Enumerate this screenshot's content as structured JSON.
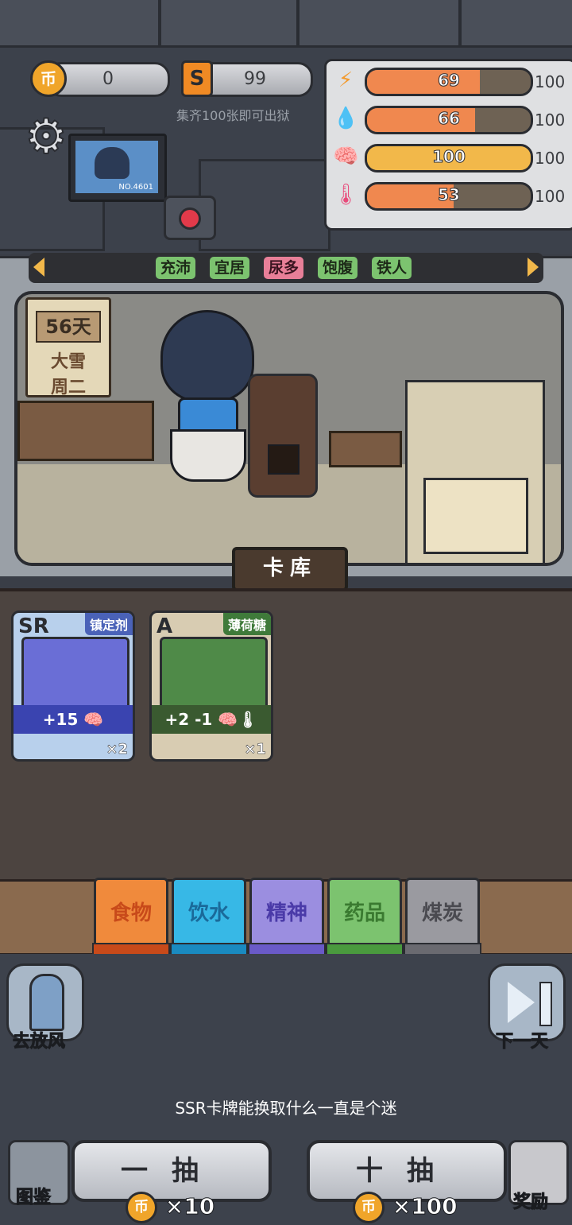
{
  "currency": {
    "coins": "0",
    "coin_glyph": "币",
    "cards": "99",
    "card_glyph": "S",
    "hint": "集齐100张即可出狱"
  },
  "stats": [
    {
      "icon": "energy-icon",
      "glyph": "⚡",
      "value": 69,
      "max": "100",
      "color": "#f0884f"
    },
    {
      "icon": "water-icon",
      "glyph": "💧",
      "value": 66,
      "max": "100",
      "color": "#f0884f"
    },
    {
      "icon": "brain-icon",
      "glyph": "🧠",
      "value": 100,
      "max": "100",
      "color": "#f2b84a"
    },
    {
      "icon": "thermometer-icon",
      "glyph": "🌡",
      "value": 53,
      "max": "100",
      "color": "#f0884f"
    }
  ],
  "camera": {
    "tag": "NO.4601"
  },
  "tags": [
    "充沛",
    "宜居",
    "尿多",
    "饱腹",
    "铁人"
  ],
  "calendar": {
    "days": "56天",
    "weather": "大雪",
    "weekday": "周二"
  },
  "card_library_title": "卡库",
  "cards": [
    {
      "rank": "SR",
      "name": "镇定剂",
      "effect": "+15",
      "count": "×2"
    },
    {
      "rank": "A",
      "name": "薄荷糖",
      "effect": "+2  -1",
      "count": "×1"
    }
  ],
  "categories": [
    {
      "label": "食物",
      "color": "#f08a3c"
    },
    {
      "label": "饮水",
      "color": "#37b8e6"
    },
    {
      "label": "精神",
      "color": "#9b8ee0"
    },
    {
      "label": "药品",
      "color": "#7cc36f"
    },
    {
      "label": "煤炭",
      "color": "#9a9aa0"
    }
  ],
  "actions": {
    "go_out": "去放风",
    "next_day": "下一天",
    "gallery": "图鉴",
    "reward": "奖励"
  },
  "tip": "SSR卡牌能换取什么一直是个迷",
  "draw_one": {
    "label": "一抽",
    "cost": "×10"
  },
  "draw_ten": {
    "label": "十抽",
    "cost": "×100"
  }
}
